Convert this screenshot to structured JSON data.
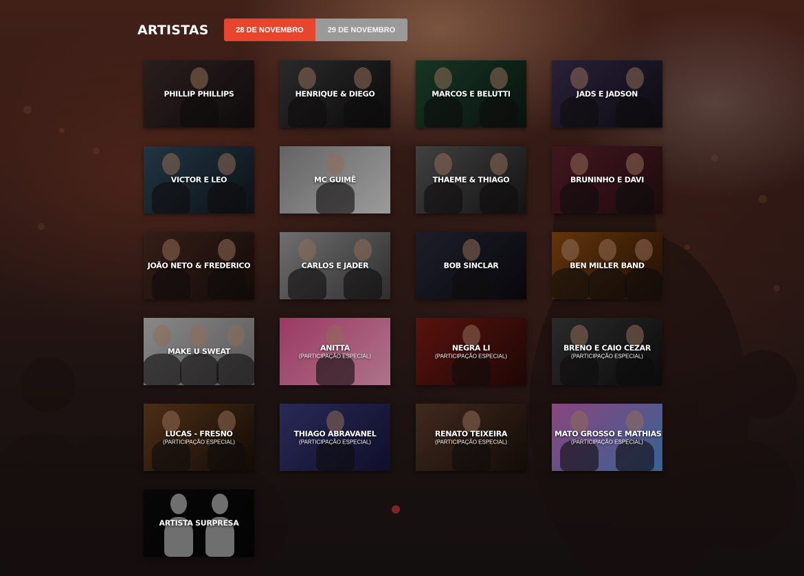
{
  "page": {
    "title": "ARTISTAS",
    "tabs": [
      {
        "label": "28 DE NOVEMBRO",
        "active": true
      },
      {
        "label": "29 DE NOVEMBRO",
        "active": false
      }
    ],
    "accent_color": "#e8452c",
    "inactive_tab_color": "#9a9a9a"
  },
  "artists": [
    {
      "name": "PHILLIP PHILLIPS",
      "note": "",
      "tone": [
        "#3b2a2a",
        "#151010"
      ],
      "figures": 1
    },
    {
      "name": "HENRIQUE & DIEGO",
      "note": "",
      "tone": [
        "#3a3a3a",
        "#0f0f0f"
      ],
      "figures": 2
    },
    {
      "name": "MARCOS E BELUTTI",
      "note": "",
      "tone": [
        "#1f4a32",
        "#0b1a13"
      ],
      "figures": 2
    },
    {
      "name": "JADS E JADSON",
      "note": "",
      "tone": [
        "#3a2d4f",
        "#101018"
      ],
      "figures": 2
    },
    {
      "name": "VICTOR E LEO",
      "note": "",
      "tone": [
        "#2f4a5a",
        "#101820"
      ],
      "figures": 2
    },
    {
      "name": "MC GUIMÊ",
      "note": "",
      "tone": [
        "#8a8a8a",
        "#d8d8d8"
      ],
      "figures": 1
    },
    {
      "name": "THAEME & THIAGO",
      "note": "",
      "tone": [
        "#5a5a5a",
        "#1a1a1a"
      ],
      "figures": 2
    },
    {
      "name": "BRUNINHO E DAVI",
      "note": "",
      "tone": [
        "#5a1f2a",
        "#2a0f14"
      ],
      "figures": 2
    },
    {
      "name": "JOÃO NETO & FREDERICO",
      "note": "",
      "tone": [
        "#4a2a20",
        "#1a0f0c"
      ],
      "figures": 2
    },
    {
      "name": "CARLOS E JADER",
      "note": "",
      "tone": [
        "#9a9a9a",
        "#404040"
      ],
      "figures": 2
    },
    {
      "name": "BOB SINCLAR",
      "note": "",
      "tone": [
        "#2a2a3a",
        "#0a0a10"
      ],
      "figures": 1
    },
    {
      "name": "BEN MILLER BAND",
      "note": "",
      "tone": [
        "#8a4a10",
        "#2a1405"
      ],
      "figures": 3
    },
    {
      "name": "MAKE U SWEAT",
      "note": "",
      "tone": [
        "#bdbdbd",
        "#7a7a7a"
      ],
      "figures": 3
    },
    {
      "name": "ANITTA",
      "note": "(PARTICIPAÇÃO ESPECIAL)",
      "tone": [
        "#d8508a",
        "#f0a0c0"
      ],
      "figures": 1
    },
    {
      "name": "NEGRA LI",
      "note": "(PARTICIPAÇÃO ESPECIAL)",
      "tone": [
        "#7a1a14",
        "#2a0a08"
      ],
      "figures": 1
    },
    {
      "name": "BRENO E CAIO CEZAR",
      "note": "(PARTICIPAÇÃO ESPECIAL)",
      "tone": [
        "#3a3a3a",
        "#101010"
      ],
      "figures": 2
    },
    {
      "name": "LUCAS - FRESNO",
      "note": "(PARTICIPAÇÃO ESPECIAL)",
      "tone": [
        "#6a4020",
        "#1a0f08"
      ],
      "figures": 2
    },
    {
      "name": "THIAGO ABRAVANEL",
      "note": "(PARTICIPAÇÃO ESPECIAL)",
      "tone": [
        "#3a3a7a",
        "#14143a"
      ],
      "figures": 1
    },
    {
      "name": "RENATO TEIXEIRA",
      "note": "(PARTICIPAÇÃO ESPECIAL)",
      "tone": [
        "#5a3a2a",
        "#1a100a"
      ],
      "figures": 1
    },
    {
      "name": "MATO GROSSO E MATHIAS",
      "note": "(PARTICIPAÇÃO ESPECIAL)",
      "tone": [
        "#c060b0",
        "#4a8ad0"
      ],
      "figures": 2
    },
    {
      "name": "ARTISTA SURPRESA",
      "note": "",
      "tone": [
        "#0a0a0a",
        "#050505"
      ],
      "figures": 0
    }
  ]
}
